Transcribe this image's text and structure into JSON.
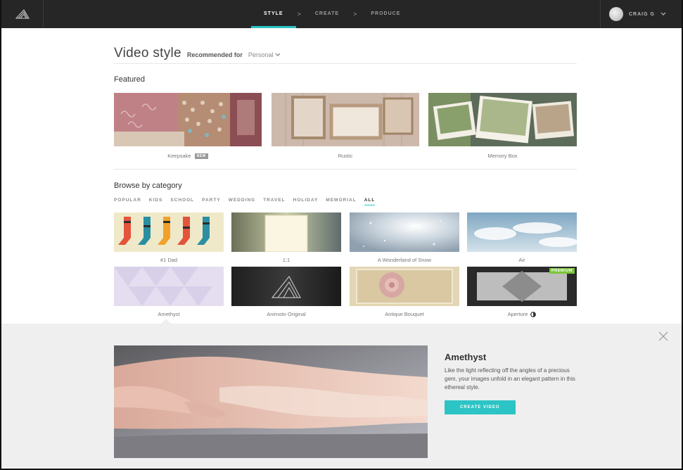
{
  "header": {
    "steps": [
      {
        "label": "STYLE",
        "active": true
      },
      {
        "label": "CREATE",
        "active": false
      },
      {
        "label": "PRODUCE",
        "active": false
      }
    ],
    "separator": ">",
    "user": {
      "name": "CRAIG G"
    }
  },
  "page": {
    "title": "Video style",
    "recommended_label": "Recommended for",
    "recommended_value": "Personal"
  },
  "featured": {
    "title": "Featured",
    "items": [
      {
        "label": "Keepsake",
        "badge": "NEW"
      },
      {
        "label": "Rustic"
      },
      {
        "label": "Memory Box"
      }
    ]
  },
  "browse": {
    "title": "Browse by category",
    "categories": [
      {
        "label": "POPULAR"
      },
      {
        "label": "KIDS"
      },
      {
        "label": "SCHOOL"
      },
      {
        "label": "PARTY"
      },
      {
        "label": "WEDDING"
      },
      {
        "label": "TRAVEL"
      },
      {
        "label": "HOLIDAY"
      },
      {
        "label": "MEMORIAL"
      },
      {
        "label": "ALL",
        "active": true
      }
    ],
    "styles": [
      {
        "label": "#1 Dad"
      },
      {
        "label": "1:1"
      },
      {
        "label": "A Wonderland of Snow"
      },
      {
        "label": "Air"
      },
      {
        "label": "Amethyst",
        "selected": true
      },
      {
        "label": "Animoto Original"
      },
      {
        "label": "Antique Bouquet"
      },
      {
        "label": "Aperture",
        "badge": "PREMIUM"
      }
    ]
  },
  "detail": {
    "title": "Amethyst",
    "description": "Like the light reflecting off the angles of a precious gem, your images unfold in an elegant pattern in this ethereal style.",
    "button_label": "CREATE VIDEO"
  },
  "colors": {
    "accent": "#2cc4c4",
    "topbar": "#262626",
    "premium": "#7cc63c",
    "panel": "#efefef"
  }
}
